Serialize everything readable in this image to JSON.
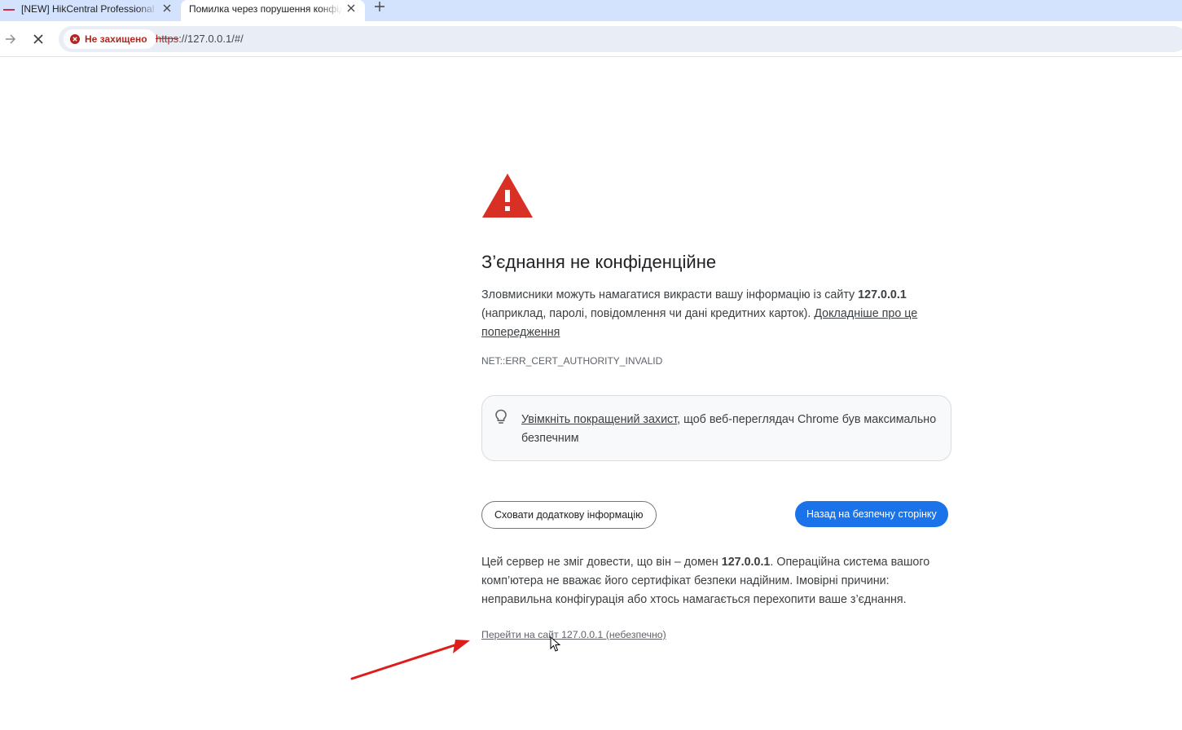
{
  "tabs": [
    {
      "title": "[NEW] HikCentral Professional V",
      "active": false
    },
    {
      "title": "Помилка через порушення конфіденційності",
      "active": true
    }
  ],
  "toolbar": {
    "security_chip": "Не захищено",
    "url_scheme": "https",
    "url_rest": "://127.0.0.1/#/"
  },
  "interstitial": {
    "heading": "З’єднання не конфіденційне",
    "p1_before": "Зловмисники можуть намагатися викрасти вашу інформацію із сайту ",
    "p1_host": "127.0.0.1",
    "p1_after": " (наприклад, паролі, повідомлення чи дані кредитних карток). ",
    "p1_link": "Докладніше про це попередження",
    "error_code": "NET::ERR_CERT_AUTHORITY_INVALID",
    "protection_link": "Увімкніть покращений захист",
    "protection_rest": ", щоб веб-переглядач Chrome був максимально безпечним",
    "hide_details_button": "Сховати додаткову інформацію",
    "back_button": "Назад на безпечну сторінку",
    "p2_before": "Цей сервер не зміг довести, що він – домен ",
    "p2_host": "127.0.0.1",
    "p2_after": ". Операційна система вашого комп’ютера не вважає його сертифікат безпеки надійним. Імовірні причини: неправильна конфігурація або хтось намагається перехопити ваше з’єднання.",
    "proceed_link": "Перейти на сайт 127.0.0.1 (небезпечно)"
  },
  "icons": {
    "warning": "warning-triangle-icon",
    "bulb": "lightbulb-icon",
    "not_secure": "not-secure-icon"
  },
  "colors": {
    "tabstrip_bg": "#d3e3fd",
    "warning_red": "#d93025",
    "primary_blue": "#1a73e8",
    "annotation_arrow": "#e01b1b"
  }
}
